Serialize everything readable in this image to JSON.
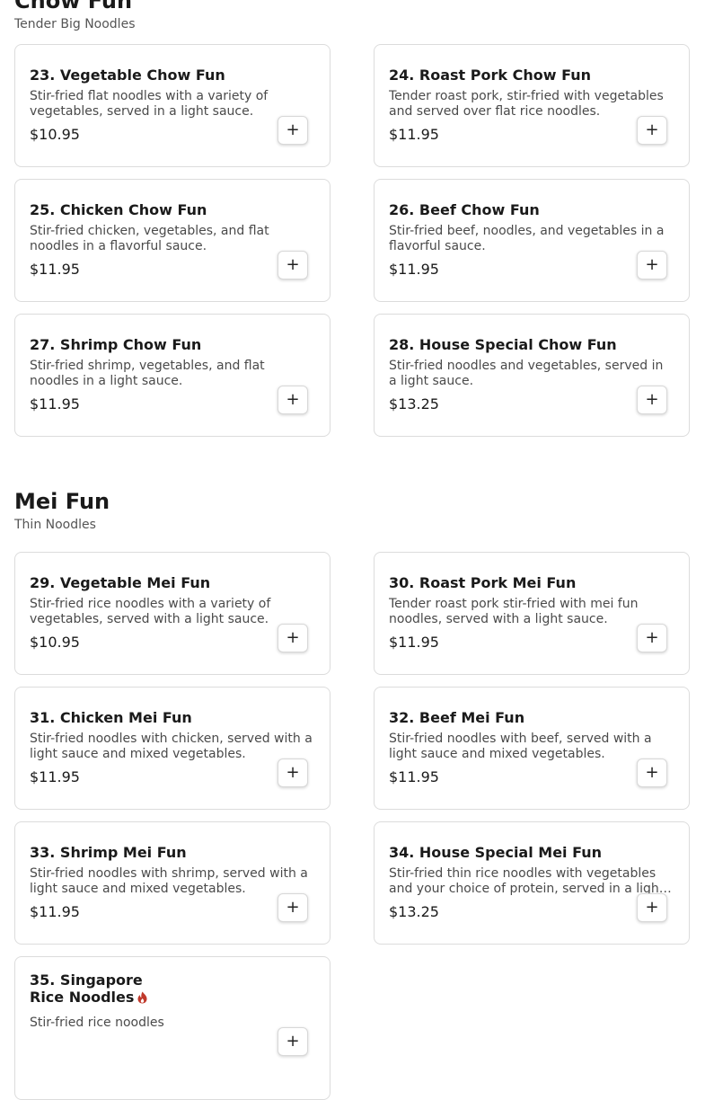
{
  "chow_fun": {
    "title": "Chow Fun",
    "subtitle": "Tender Big Noodles",
    "items": [
      {
        "name": "23. Vegetable Chow Fun",
        "desc": "Stir-fried flat noodles with a variety of vegetables, served in a light sauce.",
        "price": "$10.95"
      },
      {
        "name": "24. Roast Pork Chow Fun",
        "desc": "Tender roast pork, stir-fried with vegetables and served over flat rice noodles.",
        "price": "$11.95"
      },
      {
        "name": "25. Chicken Chow Fun",
        "desc": "Stir-fried chicken, vegetables, and flat noodles in a flavorful sauce.",
        "price": "$11.95"
      },
      {
        "name": "26. Beef Chow Fun",
        "desc": "Stir-fried beef, noodles, and vegetables in a flavorful sauce.",
        "price": "$11.95"
      },
      {
        "name": "27. Shrimp Chow Fun",
        "desc": "Stir-fried shrimp, vegetables, and flat noodles in a light sauce.",
        "price": "$11.95"
      },
      {
        "name": "28. House Special Chow Fun",
        "desc": "Stir-fried noodles and vegetables, served in a light sauce.",
        "price": "$13.25"
      }
    ]
  },
  "mei_fun": {
    "title": "Mei Fun",
    "subtitle": "Thin Noodles",
    "items": [
      {
        "name": "29. Vegetable Mei Fun",
        "desc": "Stir-fried rice noodles with a variety of vegetables, served with a light sauce.",
        "price": "$10.95"
      },
      {
        "name": "30. Roast Pork Mei Fun",
        "desc": "Tender roast pork stir-fried with mei fun noodles, served with a light sauce.",
        "price": "$11.95"
      },
      {
        "name": "31. Chicken Mei Fun",
        "desc": "Stir-fried noodles with chicken, served with a light sauce and mixed vegetables.",
        "price": "$11.95"
      },
      {
        "name": "32. Beef Mei Fun",
        "desc": "Stir-fried noodles with beef, served with a light sauce and mixed vegetables.",
        "price": "$11.95"
      },
      {
        "name": "33. Shrimp Mei Fun",
        "desc": "Stir-fried noodles with shrimp, served with a light sauce and mixed vegetables.",
        "price": "$11.95"
      },
      {
        "name": "34. House Special Mei Fun",
        "desc": "Stir-fried thin rice noodles with vegetables and your choice of protein, served in a light sauce.",
        "price": "$13.25"
      },
      {
        "name": "35. Singapore Rice Noodles",
        "desc": "Stir-fried rice noodles",
        "price": "",
        "spicy_icon": "chili-pepper-icon",
        "spicy_color": "#c0392b"
      }
    ]
  },
  "add_button_label": "+"
}
